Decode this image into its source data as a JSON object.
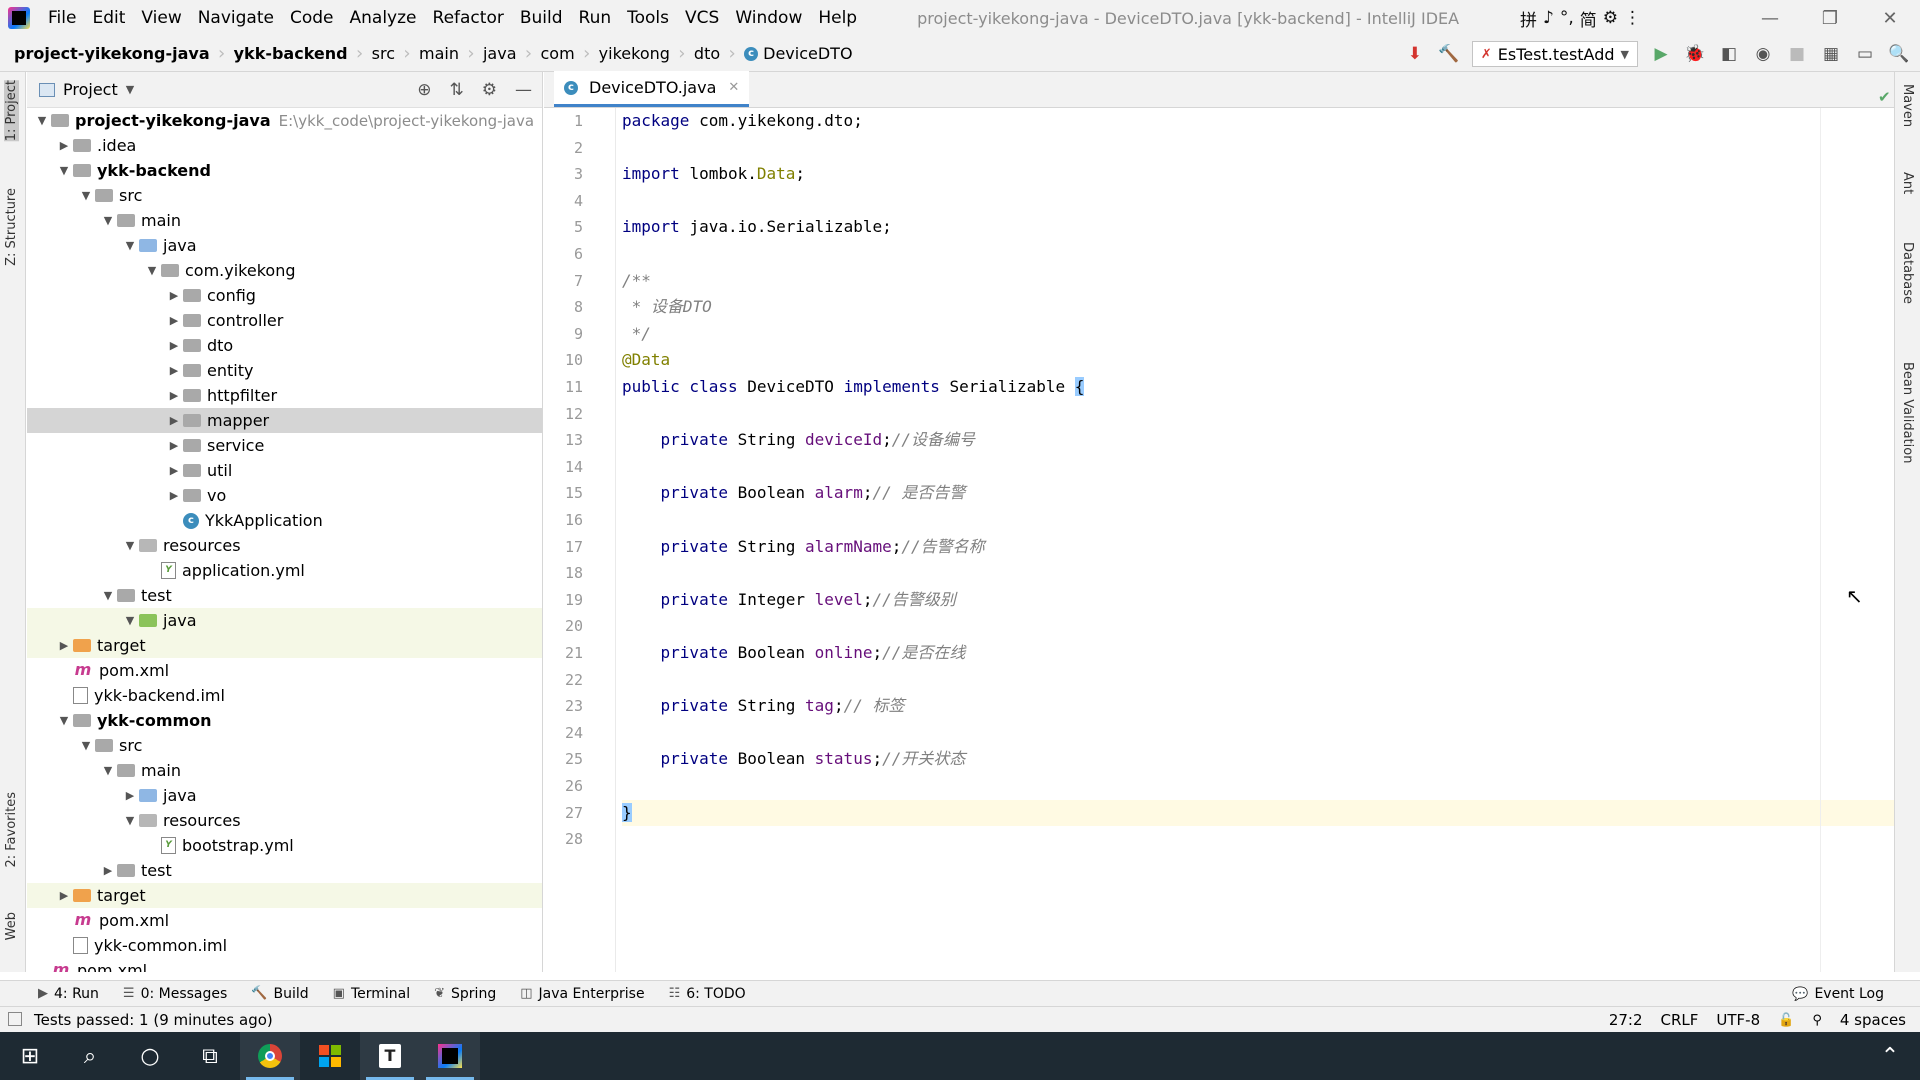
{
  "titlebar": {
    "menu": [
      "File",
      "Edit",
      "View",
      "Navigate",
      "Code",
      "Analyze",
      "Refactor",
      "Build",
      "Run",
      "Tools",
      "VCS",
      "Window",
      "Help"
    ],
    "window_title": "project-yikekong-java - DeviceDTO.java [ykk-backend] - IntelliJ IDEA",
    "ime_glyphs": [
      "拼",
      "♪",
      "°,",
      "简",
      "⚙",
      "⋮"
    ]
  },
  "navbar": {
    "crumbs": [
      "project-yikekong-java",
      "ykk-backend",
      "src",
      "main",
      "java",
      "com",
      "yikekong",
      "dto",
      "DeviceDTO"
    ],
    "run_config": "EsTest.testAdd"
  },
  "left_stripe": [
    "1: Project",
    "Z: Structure",
    "2: Favorites",
    "Web"
  ],
  "right_stripe": [
    "Maven",
    "Ant",
    "Database",
    "Bean Validation"
  ],
  "project_panel": {
    "title": "Project",
    "tree": [
      {
        "label": "project-yikekong-java",
        "path": "E:\\ykk_code\\project-yikekong-java",
        "arrow": "▼",
        "icon": "folder",
        "bold": true
      },
      {
        "label": ".idea",
        "arrow": "▶",
        "icon": "folder"
      },
      {
        "label": "ykk-backend",
        "arrow": "▼",
        "icon": "folder",
        "bold": true
      },
      {
        "label": "src",
        "arrow": "▼",
        "icon": "folder"
      },
      {
        "label": "main",
        "arrow": "▼",
        "icon": "folder"
      },
      {
        "label": "java",
        "arrow": "▼",
        "icon": "folder-blue"
      },
      {
        "label": "com.yikekong",
        "arrow": "▼",
        "icon": "folder"
      },
      {
        "label": "config",
        "arrow": "▶",
        "icon": "folder"
      },
      {
        "label": "controller",
        "arrow": "▶",
        "icon": "folder"
      },
      {
        "label": "dto",
        "arrow": "▶",
        "icon": "folder"
      },
      {
        "label": "entity",
        "arrow": "▶",
        "icon": "folder"
      },
      {
        "label": "httpfilter",
        "arrow": "▶",
        "icon": "folder"
      },
      {
        "label": "mapper",
        "arrow": "▶",
        "icon": "folder",
        "selected": true
      },
      {
        "label": "service",
        "arrow": "▶",
        "icon": "folder"
      },
      {
        "label": "util",
        "arrow": "▶",
        "icon": "folder"
      },
      {
        "label": "vo",
        "arrow": "▶",
        "icon": "folder"
      },
      {
        "label": "YkkApplication",
        "arrow": "",
        "icon": "class"
      },
      {
        "label": "resources",
        "arrow": "▼",
        "icon": "folder-res"
      },
      {
        "label": "application.yml",
        "arrow": "",
        "icon": "yml"
      },
      {
        "label": "test",
        "arrow": "▼",
        "icon": "folder"
      },
      {
        "label": "java",
        "arrow": "▼",
        "icon": "folder-green",
        "highlight": true
      },
      {
        "label": "target",
        "arrow": "▶",
        "icon": "folder-orange",
        "highlight": true
      },
      {
        "label": "pom.xml",
        "arrow": "",
        "icon": "maven"
      },
      {
        "label": "ykk-backend.iml",
        "arrow": "",
        "icon": "iml"
      },
      {
        "label": "ykk-common",
        "arrow": "▼",
        "icon": "folder",
        "bold": true
      },
      {
        "label": "src",
        "arrow": "▼",
        "icon": "folder"
      },
      {
        "label": "main",
        "arrow": "▼",
        "icon": "folder"
      },
      {
        "label": "java",
        "arrow": "▶",
        "icon": "folder-blue"
      },
      {
        "label": "resources",
        "arrow": "▼",
        "icon": "folder-res"
      },
      {
        "label": "bootstrap.yml",
        "arrow": "",
        "icon": "yml"
      },
      {
        "label": "test",
        "arrow": "▶",
        "icon": "folder"
      },
      {
        "label": "target",
        "arrow": "▶",
        "icon": "folder-orange",
        "highlight": true
      },
      {
        "label": "pom.xml",
        "arrow": "",
        "icon": "maven"
      },
      {
        "label": "ykk-common.iml",
        "arrow": "",
        "icon": "iml"
      },
      {
        "label": "pom.xml",
        "arrow": "",
        "icon": "maven"
      }
    ]
  },
  "editor": {
    "tab": "DeviceDTO.java",
    "caret_line": 27,
    "lines": [
      [
        [
          "kw",
          "package "
        ],
        [
          "t",
          "com.yikekong.dto;"
        ]
      ],
      [],
      [
        [
          "kw",
          "import "
        ],
        [
          "t",
          "lombok."
        ],
        [
          "ann",
          "Data"
        ],
        [
          "t",
          ";"
        ]
      ],
      [],
      [
        [
          "kw",
          "import "
        ],
        [
          "t",
          "java.io.Serializable;"
        ]
      ],
      [],
      [
        [
          "cmt",
          "/**"
        ]
      ],
      [
        [
          "cmt",
          " * 设备DTO"
        ]
      ],
      [
        [
          "cmt",
          " */"
        ]
      ],
      [
        [
          "ann",
          "@Data"
        ]
      ],
      [
        [
          "kw",
          "public class "
        ],
        [
          "t",
          "DeviceDTO "
        ],
        [
          "kw",
          "implements "
        ],
        [
          "t",
          "Serializable "
        ],
        [
          "brace",
          "{"
        ]
      ],
      [],
      [
        [
          "t",
          "    "
        ],
        [
          "kw",
          "private "
        ],
        [
          "t",
          "String "
        ],
        [
          "fld",
          "deviceId"
        ],
        [
          "t",
          ";"
        ],
        [
          "cmt",
          "//设备编号"
        ]
      ],
      [],
      [
        [
          "t",
          "    "
        ],
        [
          "kw",
          "private "
        ],
        [
          "t",
          "Boolean "
        ],
        [
          "fld",
          "alarm"
        ],
        [
          "t",
          ";"
        ],
        [
          "cmt",
          "// 是否告警"
        ]
      ],
      [],
      [
        [
          "t",
          "    "
        ],
        [
          "kw",
          "private "
        ],
        [
          "t",
          "String "
        ],
        [
          "fld",
          "alarmName"
        ],
        [
          "t",
          ";"
        ],
        [
          "cmt",
          "//告警名称"
        ]
      ],
      [],
      [
        [
          "t",
          "    "
        ],
        [
          "kw",
          "private "
        ],
        [
          "t",
          "Integer "
        ],
        [
          "fld",
          "level"
        ],
        [
          "t",
          ";"
        ],
        [
          "cmt",
          "//告警级别"
        ]
      ],
      [],
      [
        [
          "t",
          "    "
        ],
        [
          "kw",
          "private "
        ],
        [
          "t",
          "Boolean "
        ],
        [
          "fld",
          "online"
        ],
        [
          "t",
          ";"
        ],
        [
          "cmt",
          "//是否在线"
        ]
      ],
      [],
      [
        [
          "t",
          "    "
        ],
        [
          "kw",
          "private "
        ],
        [
          "t",
          "String "
        ],
        [
          "fld",
          "tag"
        ],
        [
          "t",
          ";"
        ],
        [
          "cmt",
          "// 标签"
        ]
      ],
      [],
      [
        [
          "t",
          "    "
        ],
        [
          "kw",
          "private "
        ],
        [
          "t",
          "Boolean "
        ],
        [
          "fld",
          "status"
        ],
        [
          "t",
          ";"
        ],
        [
          "cmt",
          "//开关状态"
        ]
      ],
      [],
      [
        [
          "brace",
          "}"
        ]
      ],
      []
    ]
  },
  "tool_windows": [
    {
      "glyph": "▶",
      "label": "4: Run"
    },
    {
      "glyph": "☰",
      "label": "0: Messages"
    },
    {
      "glyph": "🔨",
      "label": "Build"
    },
    {
      "glyph": "▣",
      "label": "Terminal"
    },
    {
      "glyph": "❦",
      "label": "Spring"
    },
    {
      "glyph": "◫",
      "label": "Java Enterprise"
    },
    {
      "glyph": "☷",
      "label": "6: TODO"
    }
  ],
  "event_log": "Event Log",
  "status": {
    "message": "Tests passed: 1 (9 minutes ago)",
    "position": "27:2",
    "line_sep": "CRLF",
    "encoding": "UTF-8",
    "indent": "4 spaces"
  }
}
